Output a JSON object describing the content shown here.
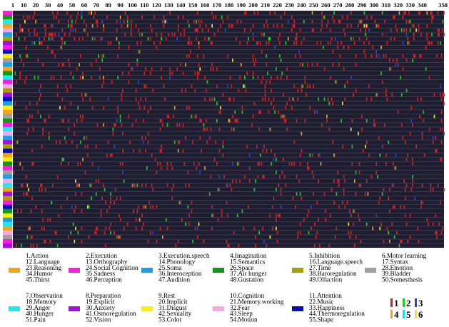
{
  "chart_data": {
    "type": "heatmap",
    "x_tick_labels": [
      "1",
      "10",
      "20",
      "30",
      "40",
      "50",
      "60",
      "70",
      "80",
      "90",
      "100",
      "110",
      "120",
      "130",
      "140",
      "150",
      "160",
      "170",
      "180",
      "190",
      "200",
      "210",
      "220",
      "230",
      "240",
      "250",
      "260",
      "270",
      "280",
      "290",
      "300",
      "310",
      "320",
      "330",
      "340",
      "358"
    ],
    "x_ticks": [
      1,
      10,
      20,
      30,
      40,
      50,
      60,
      70,
      80,
      90,
      100,
      110,
      120,
      130,
      140,
      150,
      160,
      170,
      180,
      190,
      200,
      210,
      220,
      230,
      240,
      250,
      260,
      270,
      280,
      290,
      300,
      310,
      320,
      330,
      340,
      358
    ],
    "xlim": [
      1,
      358
    ],
    "n_rows": 55,
    "background_color": "#1e1e30",
    "gridline_color": "#4a4a66",
    "cell_colors": {
      "1": "#dc1e1e",
      "2": "#22cc22",
      "3": "#2244dd",
      "4": "#f0a020",
      "5": "#20dcee",
      "6": "#f0e040"
    },
    "row_category_colors": [
      "#f5a31a",
      "#ff1ae0",
      "#1a9fea",
      "#0f9a0f",
      "#a8a000",
      "#a0a0a0",
      "#20e8f0",
      "#a010e0",
      "#ffee00",
      "#f5a8e8",
      "#0010c0"
    ],
    "legend_columns": [
      {
        "color": "#f5a31a",
        "items": [
          "1.Action",
          "12.Language",
          "23.Reasoning",
          "34.Humor",
          "45.Thirst"
        ]
      },
      {
        "color": "#ff1ae0",
        "items": [
          "2.Execution",
          "13.Orthography",
          "24.Social Cognition",
          "35.Sadness",
          "46.Perception"
        ]
      },
      {
        "color": "#1a9fea",
        "items": [
          "3.Execution.speech",
          "14.Phonology",
          "25.Soma",
          "36.Interoception",
          "47.Audition"
        ]
      },
      {
        "color": "#0f9a0f",
        "items": [
          "4.Imagination",
          "15.Semantics",
          "26.Space",
          "37.Air hunger",
          "48.Gustation"
        ]
      },
      {
        "color": "#a8a000",
        "items": [
          "5.Inhibition",
          "16.Language.speech",
          "27.Time",
          "38.Baroregulation",
          "49.Olfaction"
        ]
      },
      {
        "color": "#a0a0a0",
        "items": [
          "6.Motor learning",
          "17.Syntax",
          "28.Emotion",
          "39.Bladder",
          "50.Somesthesis"
        ]
      },
      {
        "color": "#20e8f0",
        "items": [
          "7.Observation",
          "18.Memory",
          "29.Anger",
          "40.Hunger",
          "51.Pain"
        ]
      },
      {
        "color": "#a010e0",
        "items": [
          "8.Preparation",
          "19.Explicit",
          "30.Anxiety",
          "41.Osmoregulation",
          "52.Vision"
        ]
      },
      {
        "color": "#ffee00",
        "items": [
          "9.Rest",
          "20.Implicit",
          "31.Disgust",
          "42.Sexuality",
          "53.Color"
        ]
      },
      {
        "color": "#f5a8e8",
        "items": [
          "10.Cognition",
          "21.Memory.working",
          "32.Fear",
          "43.Sleep",
          "54.Motion"
        ]
      },
      {
        "color": "#0010c0",
        "items": [
          "11.Attention",
          "22.Music",
          "33.Happiness",
          "44.Thermoregulation",
          "55.Shape"
        ]
      }
    ],
    "value_key": [
      {
        "label": "1",
        "color": "#dc1e1e"
      },
      {
        "label": "2",
        "color": "#22cc22"
      },
      {
        "label": "3",
        "color": "#2244dd"
      },
      {
        "label": "4",
        "color": "#f0a020"
      },
      {
        "label": "5",
        "color": "#20dcee"
      },
      {
        "label": "6",
        "color": "#f0e040"
      }
    ]
  }
}
